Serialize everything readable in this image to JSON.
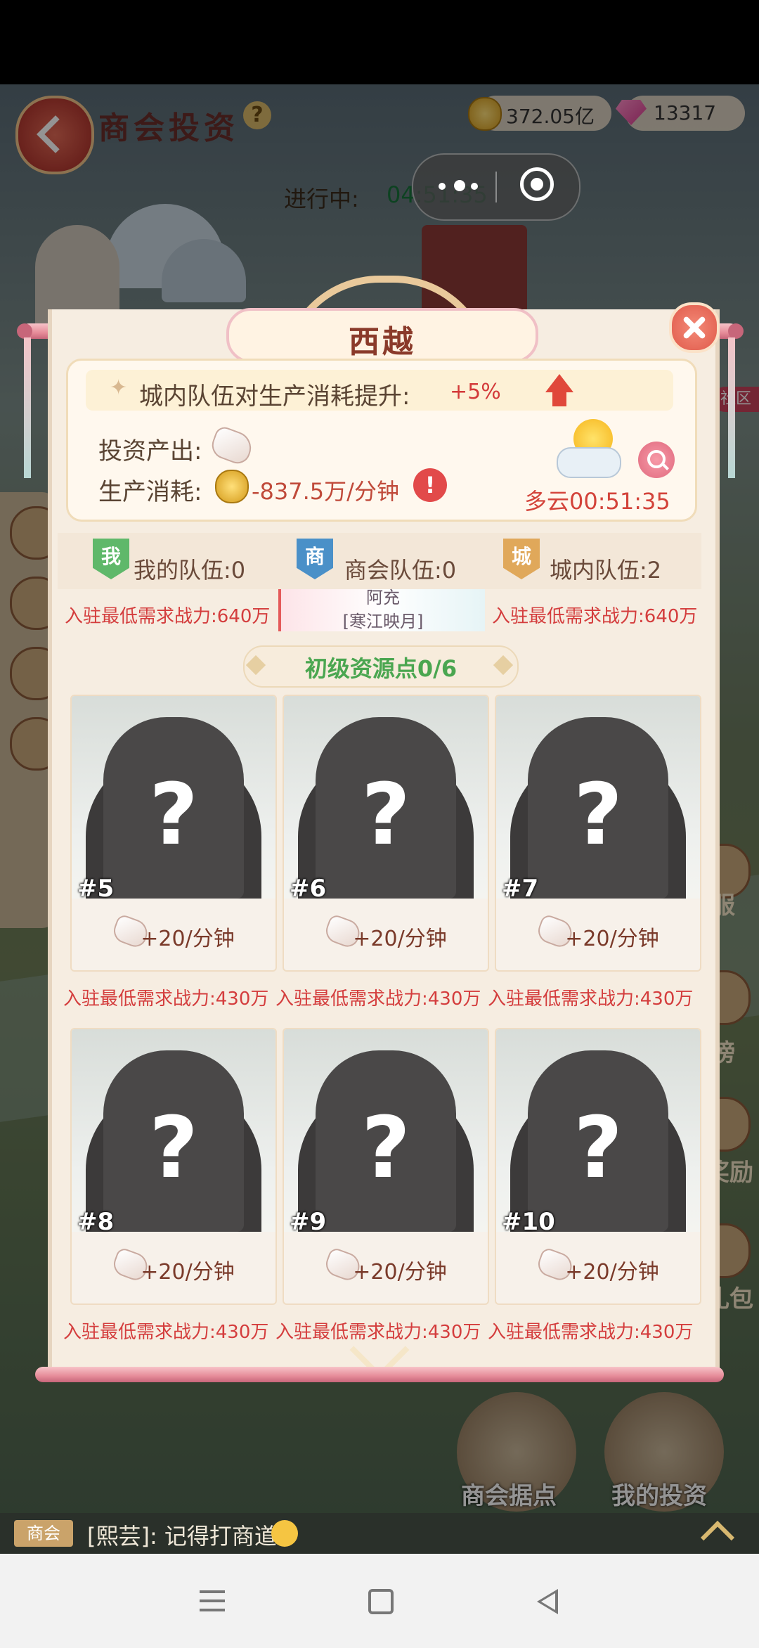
{
  "header": {
    "title": "商会投资",
    "gold": "372.05亿",
    "gems": "13317",
    "progress_label": "进行中:",
    "progress_time": "04:51:35"
  },
  "background": {
    "side_labels": [
      "服",
      "榜",
      "奖励",
      "礼包"
    ],
    "bottom_buttons": [
      "商会据点",
      "我的投资"
    ],
    "community_label": "社区"
  },
  "modal": {
    "title": "西越",
    "buff_text": "城内队伍对生产消耗提升:",
    "buff_value": "+5%",
    "output_label": "投资产出:",
    "consume_label": "生产消耗:",
    "consume_value": "-837.5万/分钟",
    "weather": "多云00:51:35",
    "tabs": [
      {
        "badge": "我",
        "label": "我的队伍:0",
        "color": "#5fb86a"
      },
      {
        "badge": "商",
        "label": "商会队伍:0",
        "color": "#4a90c8"
      },
      {
        "badge": "城",
        "label": "城内队伍:2",
        "color": "#e0a85a"
      }
    ],
    "upper_requirements": [
      "入驻最低需求战力:640万",
      "入驻最低需求战力:640万"
    ],
    "mid_card": {
      "name": "阿充",
      "tag": "[寒江映月]"
    },
    "section_title": "初级资源点0/6",
    "cards": [
      {
        "num": "#5",
        "rate": "+20/分钟",
        "req": "入驻最低需求战力:430万"
      },
      {
        "num": "#6",
        "rate": "+20/分钟",
        "req": "入驻最低需求战力:430万"
      },
      {
        "num": "#7",
        "rate": "+20/分钟",
        "req": "入驻最低需求战力:430万"
      },
      {
        "num": "#8",
        "rate": "+20/分钟",
        "req": "入驻最低需求战力:430万"
      },
      {
        "num": "#9",
        "rate": "+20/分钟",
        "req": "入驻最低需求战力:430万"
      },
      {
        "num": "#10",
        "rate": "+20/分钟",
        "req": "入驻最低需求战力:430万"
      }
    ]
  },
  "chat": {
    "tag": "商会",
    "message": "[熙芸]: 记得打商道"
  },
  "colors": {
    "accent": "#d43d3d",
    "green": "#4aa650",
    "modal_bg": "#f6ede1"
  }
}
